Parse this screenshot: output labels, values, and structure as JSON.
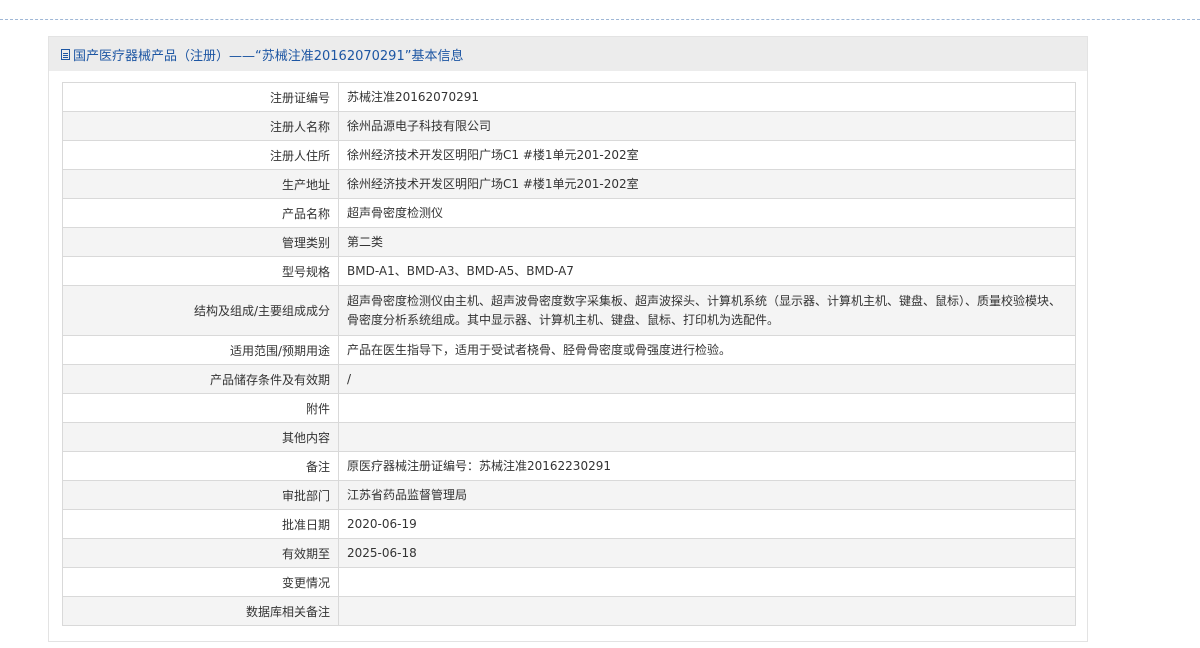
{
  "header": {
    "title": "国产医疗器械产品（注册）——“苏械注准20162070291”基本信息"
  },
  "rows": [
    {
      "label": "注册证编号",
      "value": "苏械注准20162070291"
    },
    {
      "label": "注册人名称",
      "value": "徐州品源电子科技有限公司"
    },
    {
      "label": "注册人住所",
      "value": "徐州经济技术开发区明阳广场C1 #楼1单元201-202室"
    },
    {
      "label": "生产地址",
      "value": "徐州经济技术开发区明阳广场C1 #楼1单元201-202室"
    },
    {
      "label": "产品名称",
      "value": "超声骨密度检测仪"
    },
    {
      "label": "管理类别",
      "value": "第二类"
    },
    {
      "label": "型号规格",
      "value": "BMD-A1、BMD-A3、BMD-A5、BMD-A7"
    },
    {
      "label": "结构及组成/主要组成成分",
      "value": "超声骨密度检测仪由主机、超声波骨密度数字采集板、超声波探头、计算机系统（显示器、计算机主机、键盘、鼠标）、质量校验模块、骨密度分析系统组成。其中显示器、计算机主机、键盘、鼠标、打印机为选配件。"
    },
    {
      "label": "适用范围/预期用途",
      "value": "产品在医生指导下，适用于受试者桡骨、胫骨骨密度或骨强度进行检验。"
    },
    {
      "label": "产品储存条件及有效期",
      "value": "/"
    },
    {
      "label": "附件",
      "value": ""
    },
    {
      "label": "其他内容",
      "value": ""
    },
    {
      "label": "备注",
      "value": "原医疗器械注册证编号：苏械注准20162230291"
    },
    {
      "label": "审批部门",
      "value": "江苏省药品监督管理局"
    },
    {
      "label": "批准日期",
      "value": "2020-06-19"
    },
    {
      "label": "有效期至",
      "value": "2025-06-18"
    },
    {
      "label": "变更情况",
      "value": ""
    },
    {
      "label": "数据库相关备注",
      "value": ""
    }
  ]
}
